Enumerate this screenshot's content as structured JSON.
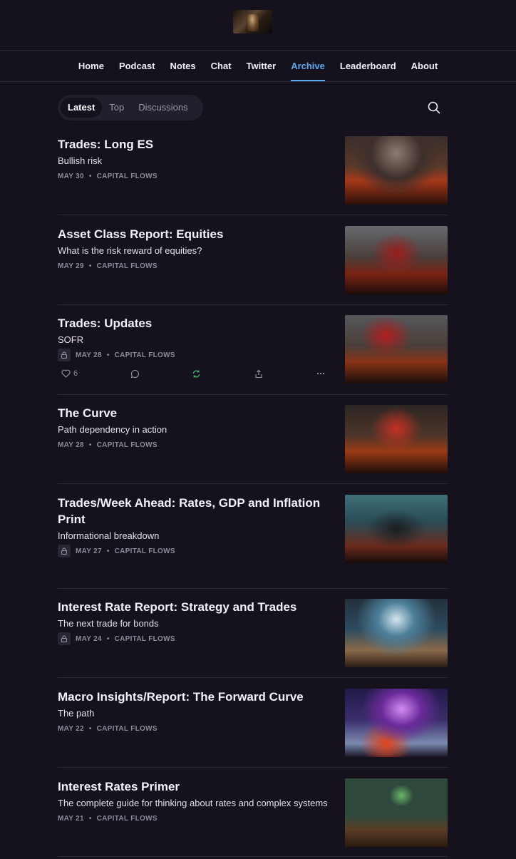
{
  "nav": {
    "items": [
      {
        "label": "Home"
      },
      {
        "label": "Podcast"
      },
      {
        "label": "Notes"
      },
      {
        "label": "Chat"
      },
      {
        "label": "Twitter"
      },
      {
        "label": "Archive"
      },
      {
        "label": "Leaderboard"
      },
      {
        "label": "About"
      }
    ],
    "active": "Archive"
  },
  "filters": {
    "tabs": [
      "Latest",
      "Top",
      "Discussions"
    ],
    "active": "Latest"
  },
  "posts": [
    {
      "title": "Trades: Long ES",
      "subtitle": "Bullish risk",
      "date": "MAY 30",
      "author": "CAPITAL FLOWS",
      "locked": false
    },
    {
      "title": "Asset Class Report: Equities",
      "subtitle": "What is the risk reward of equities?",
      "date": "MAY 29",
      "author": "CAPITAL FLOWS",
      "locked": false
    },
    {
      "title": "Trades: Updates",
      "subtitle": "SOFR",
      "date": "MAY 28",
      "author": "CAPITAL FLOWS",
      "locked": true,
      "likes": "6"
    },
    {
      "title": "The Curve",
      "subtitle": "Path dependency in action",
      "date": "MAY 28",
      "author": "CAPITAL FLOWS",
      "locked": false
    },
    {
      "title": "Trades/Week Ahead: Rates, GDP and Inflation Print",
      "subtitle": "Informational breakdown",
      "date": "MAY 27",
      "author": "CAPITAL FLOWS",
      "locked": true
    },
    {
      "title": "Interest Rate Report: Strategy and Trades",
      "subtitle": "The next trade for bonds",
      "date": "MAY 24",
      "author": "CAPITAL FLOWS",
      "locked": true
    },
    {
      "title": "Macro Insights/Report: The Forward Curve",
      "subtitle": "The path",
      "date": "MAY 22",
      "author": "CAPITAL FLOWS",
      "locked": false
    },
    {
      "title": "Interest Rates Primer",
      "subtitle": "The complete guide for thinking about rates and complex systems",
      "date": "MAY 21",
      "author": "CAPITAL FLOWS",
      "locked": false
    }
  ],
  "meta_separator": "•",
  "colors": {
    "background": "#15111d",
    "accent": "#5aa9f2",
    "restack_green": "#3dbf7a"
  }
}
